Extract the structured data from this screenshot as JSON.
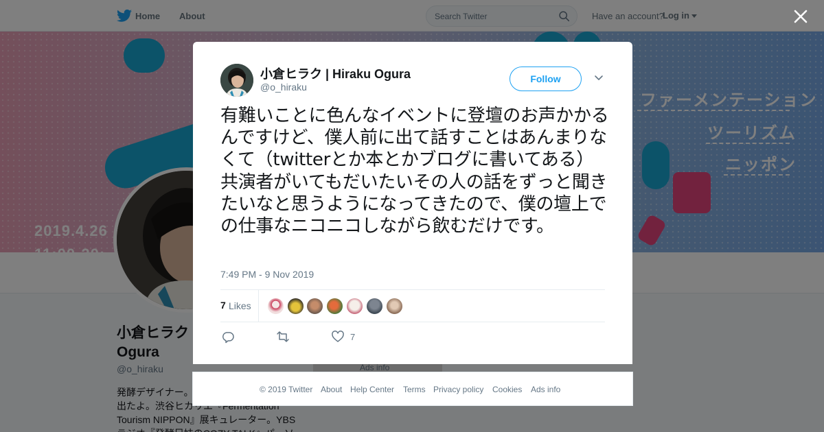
{
  "nav": {
    "home_label": "Home",
    "about_label": "About",
    "search_placeholder": "Search Twitter",
    "have_account": "Have an account?",
    "login_label": "Log in"
  },
  "banner": {
    "lines": [
      "ファーメンテーション",
      "ツーリズム",
      "ニッポン"
    ],
    "date": "2019.4.26",
    "time_partial": "11:00-20:"
  },
  "profile": {
    "name": "小倉ヒラク Ogura",
    "handle": "@o_hiraku",
    "bio": "発酵デザイナー。…\n出たよ。渋谷ヒカリエ『Fermentation\nTourism NIPPON』展キュレーター。YBS\nラジオ『発酵兄妹のCOZY TALK』パーソ",
    "ads_label": "Ads info"
  },
  "tweet": {
    "author_name": "小倉ヒラク | Hiraku Ogura",
    "author_handle": "@o_hiraku",
    "follow_label": "Follow",
    "text": "有難いことに色んなイベントに登壇のお声かかるんですけど、僕人前に出て話すことはあんまりなくて（twitterとか本とかブログに書いてある）共演者がいてもだいたいその人の話をずっと聞きたいなと思うようになってきたので、僕の壇上での仕事なニコニコしながら飲むだけです。",
    "timestamp": "7:49 PM - 9 Nov 2019",
    "likes_count": "7",
    "likes_label": "Likes",
    "like_action_count": "7"
  },
  "footer": {
    "copyright": "© 2019 Twitter",
    "links": [
      "About",
      "Help Center",
      "Terms",
      "Privacy policy",
      "Cookies",
      "Ads info"
    ]
  },
  "colors": {
    "twitter_blue": "#1da1f2",
    "overlay": "rgba(0,0,0,0.5)",
    "text_secondary": "#657786"
  },
  "icons": {
    "logo": "twitter-bird-icon",
    "search": "search-icon",
    "close": "close-icon",
    "chevron": "chevron-down-icon",
    "reply": "reply-icon",
    "retweet": "retweet-icon",
    "like": "heart-icon"
  }
}
